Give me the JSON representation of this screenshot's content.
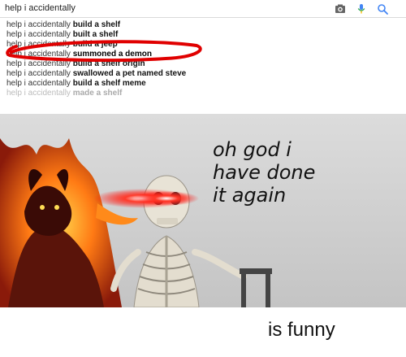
{
  "search": {
    "query": "help i accidentally",
    "icons": [
      "camera-icon",
      "microphone-icon",
      "search-icon"
    ]
  },
  "suggestions": [
    {
      "prefix": "help i accidentally ",
      "bold": "build a shelf",
      "style": "normal"
    },
    {
      "prefix": "help i accidentally ",
      "bold": "built a shelf",
      "style": "normal"
    },
    {
      "prefix": "help i accidentally ",
      "bold": "build a jeep",
      "style": "normal"
    },
    {
      "prefix": "help i accidentally ",
      "bold": "summoned a demon",
      "style": "highlight"
    },
    {
      "prefix": "help i accidentally ",
      "bold": "build a shelf origin",
      "style": "normal"
    },
    {
      "prefix": "help i accidentally ",
      "bold": "swallowed a pet named steve",
      "style": "normal"
    },
    {
      "prefix": "help i accidentally ",
      "bold": "build a shelf meme",
      "style": "normal"
    },
    {
      "prefix": "help i accidentally ",
      "bold": "made a shelf",
      "style": "faded"
    }
  ],
  "meme": {
    "caption": "oh god i\nhave done\nit again"
  },
  "footer": {
    "caption": "is funny"
  },
  "colors": {
    "annotation": "#e00000",
    "background": "#ffffff",
    "panel": "#cfcfcf"
  }
}
